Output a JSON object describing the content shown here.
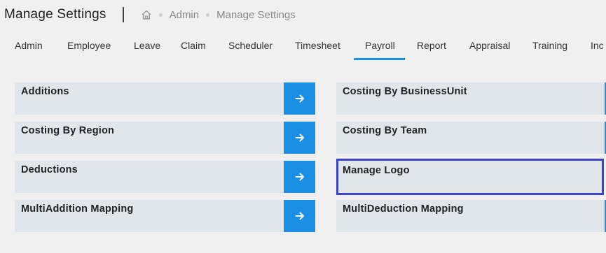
{
  "header": {
    "title": "Manage Settings",
    "breadcrumb": [
      "Admin",
      "Manage Settings"
    ]
  },
  "tabs": [
    "Admin",
    "Employee",
    "Leave",
    "Claim",
    "Scheduler",
    "Timesheet",
    "Payroll",
    "Report",
    "Appraisal",
    "Training",
    "Inc"
  ],
  "active_tab": "Payroll",
  "settings": {
    "left": [
      {
        "label": "Additions"
      },
      {
        "label": "Costing By Region"
      },
      {
        "label": "Deductions"
      },
      {
        "label": "MultiAddition Mapping"
      }
    ],
    "right": [
      {
        "label": "Costing By BusinessUnit"
      },
      {
        "label": "Costing By Team"
      },
      {
        "label": "Manage Logo"
      },
      {
        "label": "MultiDeduction Mapping"
      }
    ]
  },
  "colors": {
    "accent": "#1a8fe3",
    "card_bg": "#e1e6ed",
    "focus_border": "#3b44c4"
  },
  "icons": {
    "home": "home-icon",
    "go": "arrow-right-icon"
  }
}
